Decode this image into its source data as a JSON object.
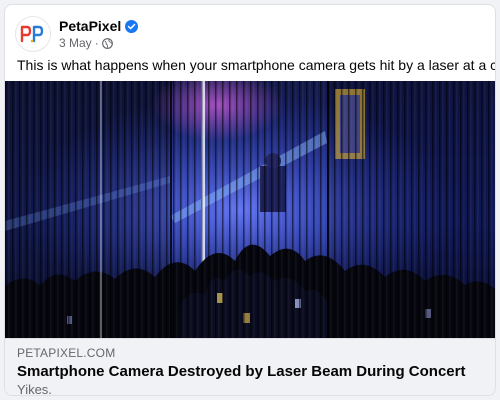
{
  "post": {
    "page_name": "PetaPixel",
    "date": "3 May",
    "separator": "·",
    "caption": "This is what happens when your smartphone camera gets hit by a laser at a concert."
  },
  "link_preview": {
    "domain": "PETAPIXEL.COM",
    "title": "Smartphone Camera Destroyed by Laser Beam During Concert",
    "description": "Yikes."
  },
  "icons": {
    "avatar": "petapixel-logo",
    "verified": "verified-badge-icon",
    "audience": "globe-icon"
  },
  "colors": {
    "verified_blue": "#1877f2",
    "text_primary": "#050505",
    "text_secondary": "#65676b",
    "link_bg": "#f0f2f5"
  }
}
